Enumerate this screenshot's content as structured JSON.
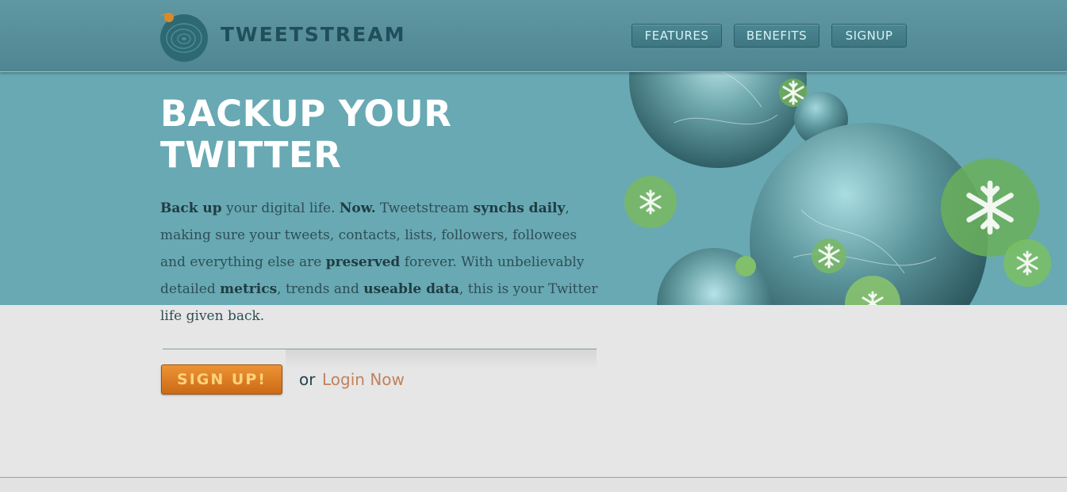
{
  "header": {
    "brand": "TWEETSTREAM",
    "nav": [
      {
        "label": "FEATURES"
      },
      {
        "label": "BENEFITS"
      },
      {
        "label": "SIGNUP"
      }
    ]
  },
  "hero": {
    "headline_line1": "BACKUP YOUR",
    "headline_line2": "TWITTER"
  },
  "intro": {
    "p1": "Back up",
    "p2": " your digital life. ",
    "p3": "Now.",
    "p4": " Tweetstream ",
    "p5": "synchs daily",
    "p6": ", making sure your tweets, contacts, lists, followers, followees and everything else are ",
    "p7": "preserved",
    "p8": " forever. With unbelievably detailed ",
    "p9": "metrics",
    "p10": ", trends and ",
    "p11": "useable data",
    "p12": ", this is your Twitter life given back."
  },
  "cta": {
    "signup_label": "SIGN UP!",
    "or_text": "or",
    "login_label": "Login Now"
  },
  "colors": {
    "header_bg": "#55909b",
    "hero_bg": "#68a9b3",
    "accent_orange": "#d9781f",
    "link": "#c0825d"
  }
}
